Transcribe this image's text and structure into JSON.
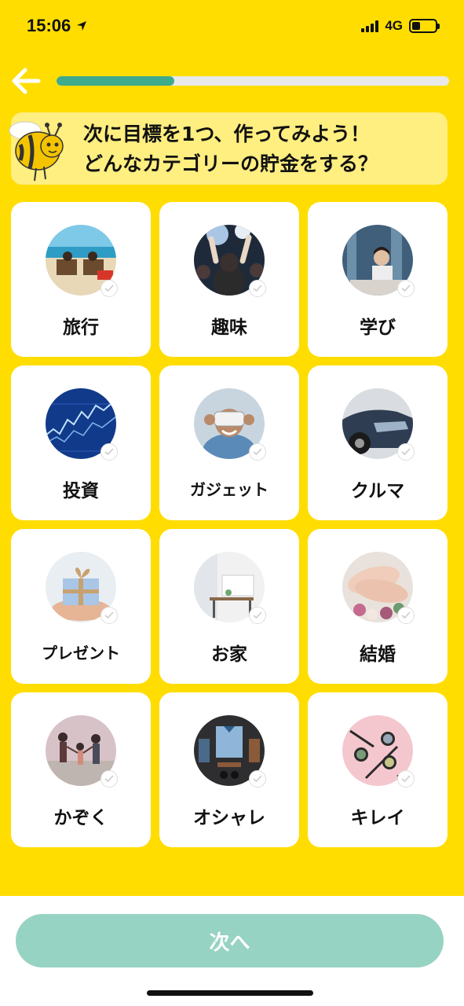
{
  "status": {
    "time": "15:06",
    "network": "4G"
  },
  "header": {
    "progress": 0.3
  },
  "title": {
    "line1": "次に目標を1つ、作ってみよう！",
    "line2": "どんなカテゴリーの貯金をする？"
  },
  "categories": [
    {
      "label": "旅行",
      "icon": "travel-beach-photo"
    },
    {
      "label": "趣味",
      "icon": "concert-photo"
    },
    {
      "label": "学び",
      "icon": "study-photo"
    },
    {
      "label": "投資",
      "icon": "stock-chart-photo"
    },
    {
      "label": "ガジェット",
      "icon": "vr-headset-photo"
    },
    {
      "label": "クルマ",
      "icon": "car-photo"
    },
    {
      "label": "プレゼント",
      "icon": "gift-box-photo"
    },
    {
      "label": "お家",
      "icon": "home-interior-photo"
    },
    {
      "label": "結婚",
      "icon": "wedding-rings-photo"
    },
    {
      "label": "かぞく",
      "icon": "family-photo"
    },
    {
      "label": "オシャレ",
      "icon": "fashion-flatlay-photo"
    },
    {
      "label": "キレイ",
      "icon": "cosmetics-photo"
    }
  ],
  "next_button": {
    "label": "次へ"
  },
  "colors": {
    "background": "#FFDD00",
    "progress": "#3FAA8C",
    "button": "#97D3C2",
    "banner": "#FFEE80"
  }
}
